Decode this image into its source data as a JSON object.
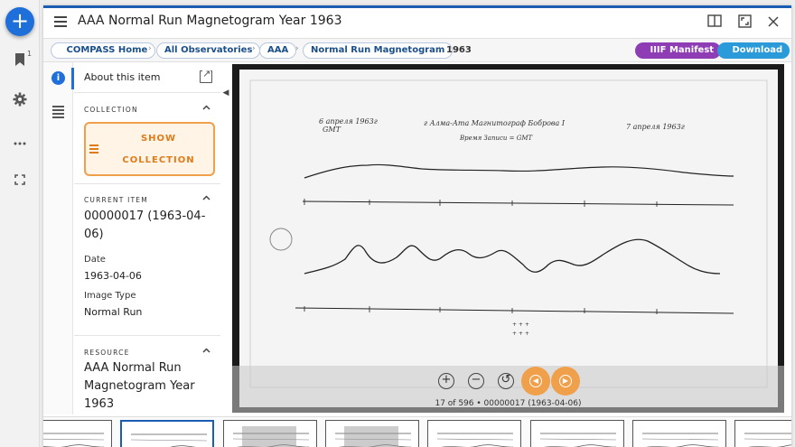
{
  "rail": {
    "add_icon": "plus-icon",
    "bookmark_badge": "1",
    "icons": [
      "bookmark-icon",
      "gear-icon",
      "more-icon",
      "fullscreen-icon"
    ]
  },
  "window": {
    "title": "AAA Normal Run Magnetogram Year 1963",
    "accent": "#1a5db3"
  },
  "breadcrumbs": [
    {
      "label": "  COMPASS Home"
    },
    {
      "label": "All Observatories"
    },
    {
      "label": "AAA"
    },
    {
      "label": "Normal Run Magnetogram"
    },
    {
      "label": "1963"
    }
  ],
  "actions": {
    "iiif_label": "  IIIF Manifest",
    "iiif_color": "#8e3db5",
    "download_label": "  Download",
    "download_color": "#2a9bd8"
  },
  "panel": {
    "about_label": "About this item",
    "collection_heading": "COLLECTION",
    "show_collection_line1": "SHOW",
    "show_collection_line2": "COLLECTION",
    "current_heading": "CURRENT ITEM",
    "current_line1": "00000017 (1963-04-",
    "current_line2": "06)",
    "date_label": "Date",
    "date_value": "1963-04-06",
    "type_label": "Image Type",
    "type_value": "Normal Run",
    "resource_heading": "RESOURCE",
    "resource_line1": "AAA Normal Run",
    "resource_line2": "Magnetogram Year",
    "resource_line3": "1963"
  },
  "viewer": {
    "status": "17 of 596 • 00000017 (1963-04-06)",
    "nav_color": "#f0a04b",
    "handwriting": {
      "left_date": "6 апреля 1963г",
      "left_tz": "GMT",
      "center_title": "г Алма-Ата  Магнитограф Боброва I",
      "center_sub": "Время Записи = GMT",
      "right_date": "7 апреля  1963г"
    }
  }
}
